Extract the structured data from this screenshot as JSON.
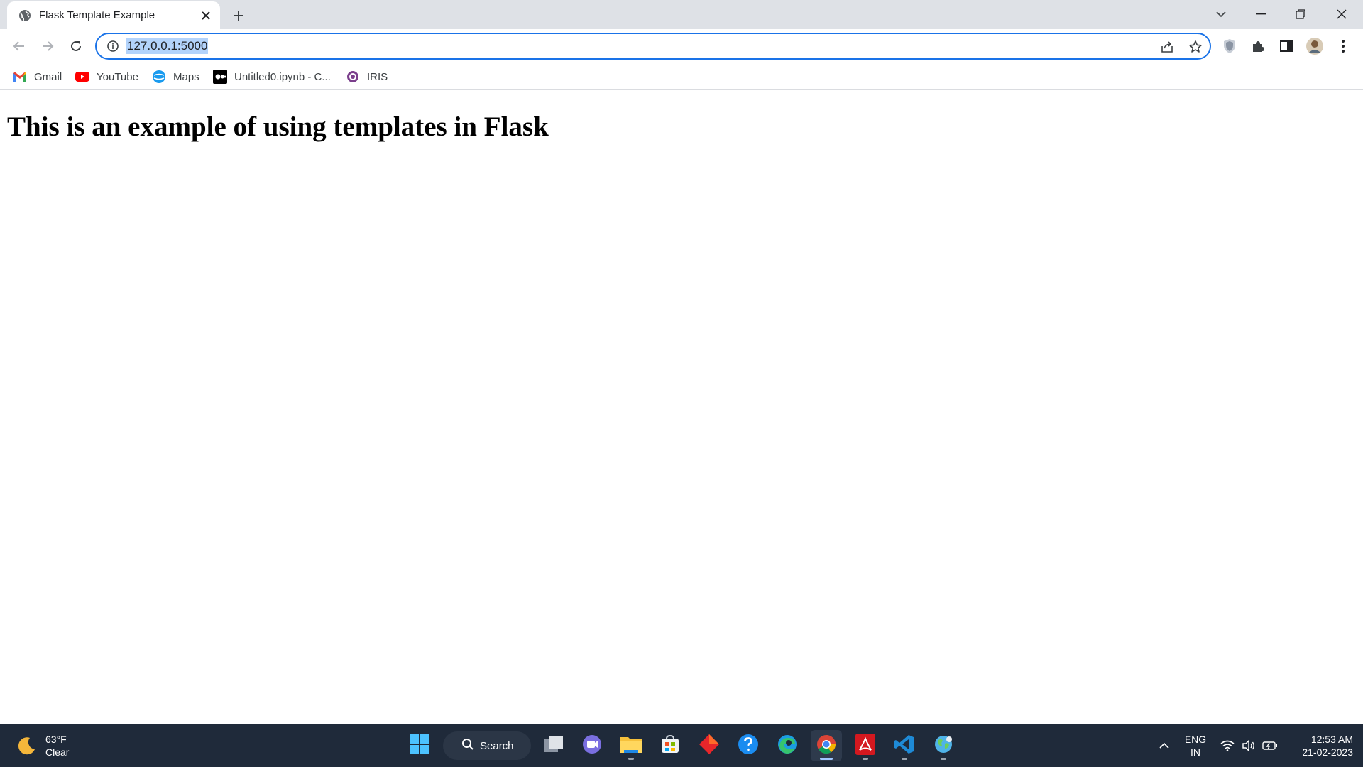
{
  "browser": {
    "tab": {
      "title": "Flask Template Example"
    },
    "address_bar": {
      "url": "127.0.0.1:5000"
    },
    "bookmarks": [
      {
        "label": "Gmail",
        "icon": "gmail-icon"
      },
      {
        "label": "YouTube",
        "icon": "youtube-icon"
      },
      {
        "label": "Maps",
        "icon": "maps-icon"
      },
      {
        "label": "Untitled0.ipynb - C...",
        "icon": "colab-icon"
      },
      {
        "label": "IRIS",
        "icon": "iris-icon"
      }
    ]
  },
  "page": {
    "heading": "This is an example of using templates in Flask"
  },
  "taskbar": {
    "weather": {
      "temp": "63°F",
      "condition": "Clear",
      "icon": "moon-icon"
    },
    "search_label": "Search",
    "apps": [
      {
        "name": "start",
        "icon": "windows-start-icon"
      },
      {
        "name": "task-view",
        "icon": "task-view-icon"
      },
      {
        "name": "chat",
        "icon": "chat-icon"
      },
      {
        "name": "file-explorer",
        "icon": "folder-icon"
      },
      {
        "name": "microsoft-store",
        "icon": "store-icon"
      },
      {
        "name": "app-red",
        "icon": "red-diamond-icon"
      },
      {
        "name": "get-help",
        "icon": "help-icon"
      },
      {
        "name": "edge",
        "icon": "edge-icon"
      },
      {
        "name": "chrome",
        "icon": "chrome-icon"
      },
      {
        "name": "acrobat",
        "icon": "acrobat-icon"
      },
      {
        "name": "vscode",
        "icon": "vscode-icon"
      },
      {
        "name": "anaconda",
        "icon": "globe-icon"
      }
    ],
    "language": {
      "line1": "ENG",
      "line2": "IN"
    },
    "clock": {
      "time": "12:53 AM",
      "date": "21-02-2023"
    }
  },
  "colors": {
    "accent": "#1a73e8",
    "tabstrip_bg": "#dee1e6",
    "taskbar_bg": "#1f2a3a",
    "url_selection": "#b3d3fb"
  }
}
